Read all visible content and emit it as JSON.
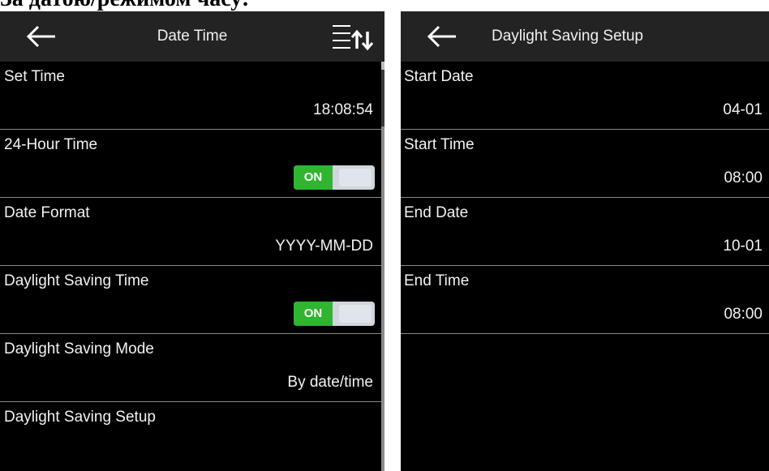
{
  "caption": "За датою/режимом часу:",
  "left_screen": {
    "title": "Date Time",
    "icons": {
      "back": "back-arrow-icon",
      "sort": "sort-icon"
    },
    "rows": [
      {
        "label": "Set Time",
        "value": "18:08:54"
      },
      {
        "label": "24-Hour Time",
        "toggle": "ON"
      },
      {
        "label": "Date Format",
        "value": "YYYY-MM-DD"
      },
      {
        "label": "Daylight Saving Time",
        "toggle": "ON"
      },
      {
        "label": "Daylight Saving Mode",
        "value": "By date/time"
      },
      {
        "label": "Daylight Saving Setup"
      }
    ]
  },
  "right_screen": {
    "title": "Daylight Saving Setup",
    "icons": {
      "back": "back-arrow-icon"
    },
    "rows": [
      {
        "label": "Start Date",
        "value": "04-01"
      },
      {
        "label": "Start Time",
        "value": "08:00"
      },
      {
        "label": "End Date",
        "value": "10-01"
      },
      {
        "label": "End Time",
        "value": "08:00"
      }
    ]
  },
  "colors": {
    "screen_bg": "#000000",
    "header_bg": "#232323",
    "toggle_on": "#2fb52f",
    "toggle_off": "#cfd6dc",
    "divider": "#8a8a8a"
  }
}
